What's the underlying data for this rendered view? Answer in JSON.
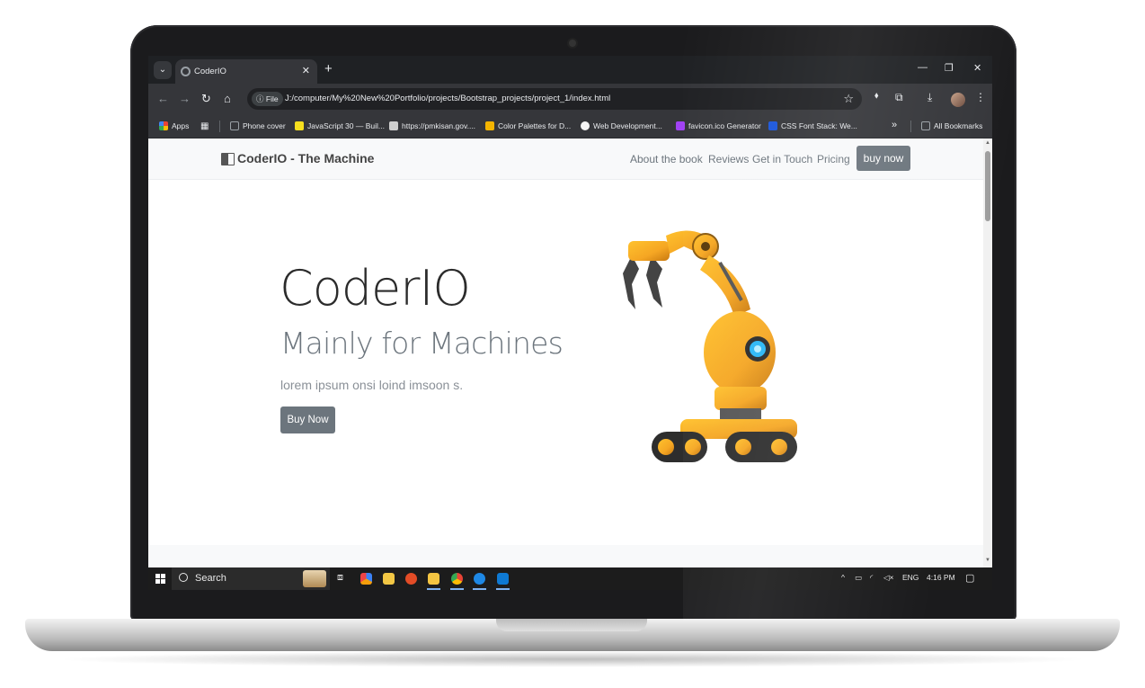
{
  "browser": {
    "tab_title": "CoderIO",
    "url_chip": "File",
    "url": "J:/computer/My%20New%20Portfolio/projects/Bootstrap_projects/project_1/index.html",
    "bookmarks": [
      {
        "label": "Apps",
        "color": "#ea4335"
      },
      {
        "label": "Phone cover",
        "color": "#9aa0a6"
      },
      {
        "label": "JavaScript 30 — Buil...",
        "color": "#f7df1e"
      },
      {
        "label": "https://pmkisan.gov....",
        "color": "#cfcfcf"
      },
      {
        "label": "Color Palettes for D...",
        "color": "#f4b400"
      },
      {
        "label": "Web Development...",
        "color": "#f5f5f5"
      },
      {
        "label": "favicon.ico Generator",
        "color": "#a142f4"
      },
      {
        "label": "CSS Font Stack: We...",
        "color": "#1a56db"
      }
    ],
    "all_bookmarks": "All Bookmarks"
  },
  "site": {
    "brand": "CoderIO - The Machine",
    "nav": [
      "About the book",
      "Reviews",
      "Get in Touch",
      "Pricing"
    ],
    "nav_button": "buy now",
    "hero_title": "CoderIO",
    "hero_subtitle": "Mainly for Machines",
    "hero_text": "lorem ipsum onsi loind imsoon s.",
    "hero_button": "Buy Now"
  },
  "taskbar": {
    "search": "Search",
    "lang": "ENG",
    "time": "4:16 PM"
  },
  "colors": {
    "accent_button": "#6c757d",
    "robot_body": "#f5a623"
  }
}
